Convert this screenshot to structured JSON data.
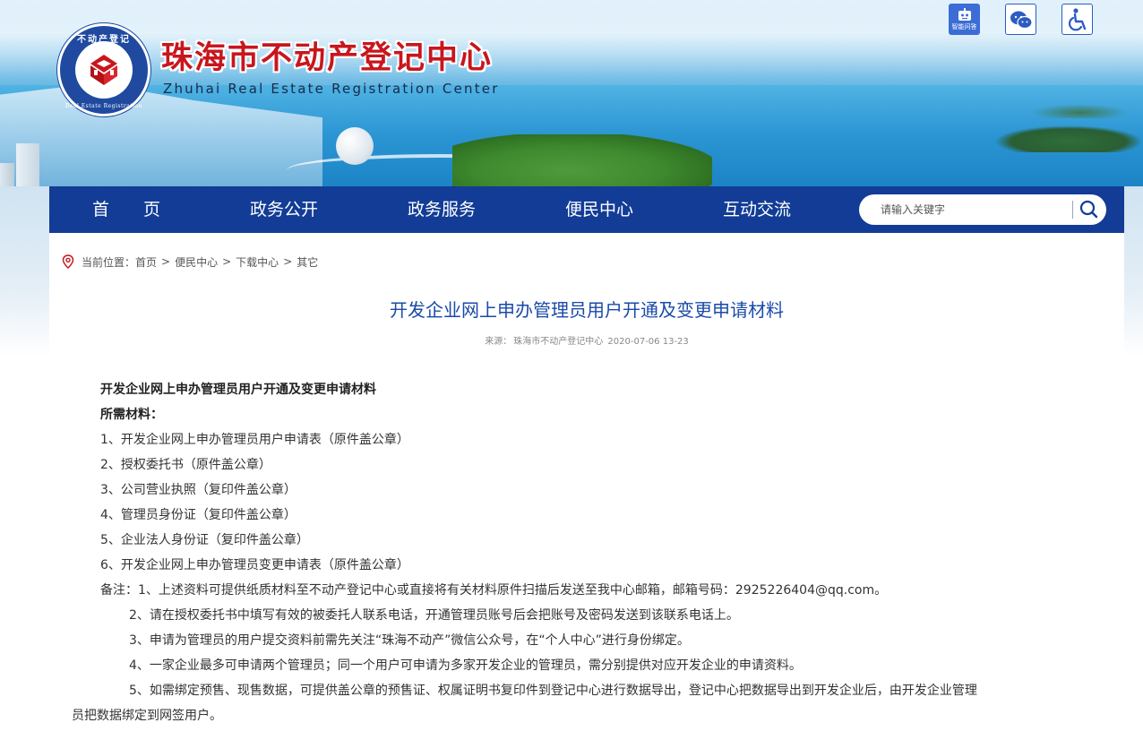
{
  "header": {
    "title": "珠海市不动产登记中心",
    "subtitle": "Zhuhai Real Estate Registration Center",
    "logo_ring_top": "不动产登记",
    "logo_ring_bottom": "Real Estate Registration",
    "icons": {
      "robot_label": "智能问答",
      "robot_icon": "robot-icon",
      "wechat_icon": "wechat-icon",
      "accessibility_icon": "accessibility-icon"
    },
    "colors": {
      "title_red": "#c8161d",
      "nav_blue": "#123c96",
      "logo_blue": "#1f4aa0"
    }
  },
  "nav": {
    "items": [
      {
        "label": "首　　页"
      },
      {
        "label": "政务公开"
      },
      {
        "label": "政务服务"
      },
      {
        "label": "便民中心"
      },
      {
        "label": "互动交流"
      }
    ],
    "search": {
      "placeholder": "请输入关键字",
      "value": ""
    }
  },
  "breadcrumb": {
    "prefix": "当前位置：",
    "items": [
      "首页",
      "便民中心",
      "下载中心",
      "其它"
    ],
    "separator": ">"
  },
  "article": {
    "title": "开发企业网上申办管理员用户开通及变更申请材料",
    "source_label": "来源：",
    "source": "珠海市不动产登记中心",
    "date": "2020-07-06 13-23",
    "lines": [
      "开发企业网上申办管理员用户开通及变更申请材料",
      "所需材料：",
      "1、开发企业网上申办管理员用户申请表（原件盖公章）",
      "2、授权委托书（原件盖公章）",
      "3、公司营业执照（复印件盖公章）",
      "4、管理员身份证（复印件盖公章）",
      "5、企业法人身份证（复印件盖公章）",
      "6、开发企业网上申办管理员变更申请表（原件盖公章）",
      "备注：1、上述资料可提供纸质材料至不动产登记中心或直接将有关材料原件扫描后发送至我中心邮箱，邮箱号码：2925226404@qq.com。",
      "2、请在授权委托书中填写有效的被委托人联系电话，开通管理员账号后会把账号及密码发送到该联系电话上。",
      "3、申请为管理员的用户提交资料前需先关注“珠海不动产”微信公众号，在“个人中心”进行身份绑定。",
      "4、一家企业最多可申请两个管理员；同一个用户可申请为多家开发企业的管理员，需分别提供对应开发企业的申请资料。",
      "5、如需绑定预售、现售数据，可提供盖公章的预售证、权属证明书复印件到登记中心进行数据导出，登记中心把数据导出到开发企业后，由开发企业管理",
      "员把数据绑定到网签用户。"
    ]
  }
}
